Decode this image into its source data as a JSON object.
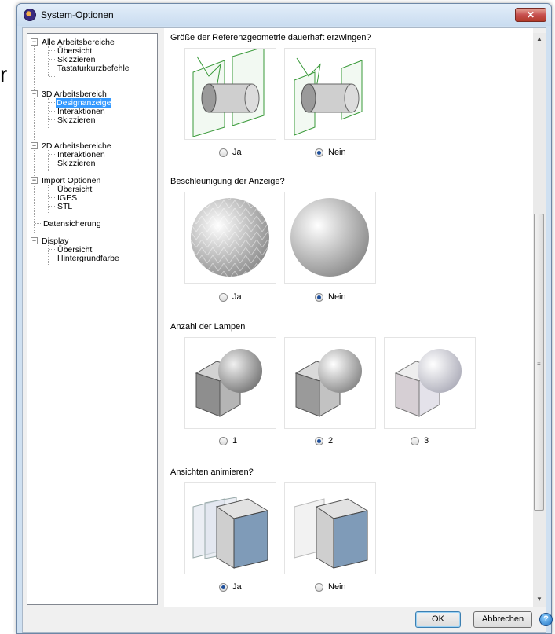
{
  "background": {
    "text": "r"
  },
  "window": {
    "title": "System-Optionen",
    "close_glyph": "✕",
    "icon": "app-logo-icon"
  },
  "tree": {
    "nodes": [
      {
        "label": "Alle Arbeitsbereiche",
        "toggle": "−"
      },
      {
        "label": "Übersicht"
      },
      {
        "label": "Skizzieren"
      },
      {
        "label": "Tastaturkurzbefehle"
      },
      {
        "label": "3D Arbeitsbereich",
        "toggle": "−"
      },
      {
        "label": "Designanzeige",
        "selected": true
      },
      {
        "label": "Interaktionen"
      },
      {
        "label": "Skizzieren"
      },
      {
        "label": "2D Arbeitsbereiche",
        "toggle": "−"
      },
      {
        "label": "Interaktionen"
      },
      {
        "label": "Skizzieren"
      },
      {
        "label": "Import Optionen",
        "toggle": "−"
      },
      {
        "label": "Übersicht"
      },
      {
        "label": "IGES"
      },
      {
        "label": "STL"
      },
      {
        "label": "Datensicherung"
      },
      {
        "label": "Display",
        "toggle": "−"
      },
      {
        "label": "Übersicht"
      },
      {
        "label": "Hintergrundfarbe"
      }
    ]
  },
  "sections": [
    {
      "title": "Größe der Referenzgeometrie dauerhaft erzwingen?",
      "options": [
        "Ja",
        "Nein"
      ],
      "selected": 1
    },
    {
      "title": "Beschleunigung der Anzeige?",
      "options": [
        "Ja",
        "Nein"
      ],
      "selected": 1
    },
    {
      "title": "Anzahl der Lampen",
      "options": [
        "1",
        "2",
        "3"
      ],
      "selected": 1
    },
    {
      "title": "Ansichten animieren?",
      "options": [
        "Ja",
        "Nein"
      ],
      "selected": 0
    }
  ],
  "buttons": {
    "ok": "OK",
    "cancel": "Abbrechen",
    "help": "?"
  },
  "colors": {
    "selection": "#3399ff",
    "radio_dot": "#1e4f9b"
  }
}
